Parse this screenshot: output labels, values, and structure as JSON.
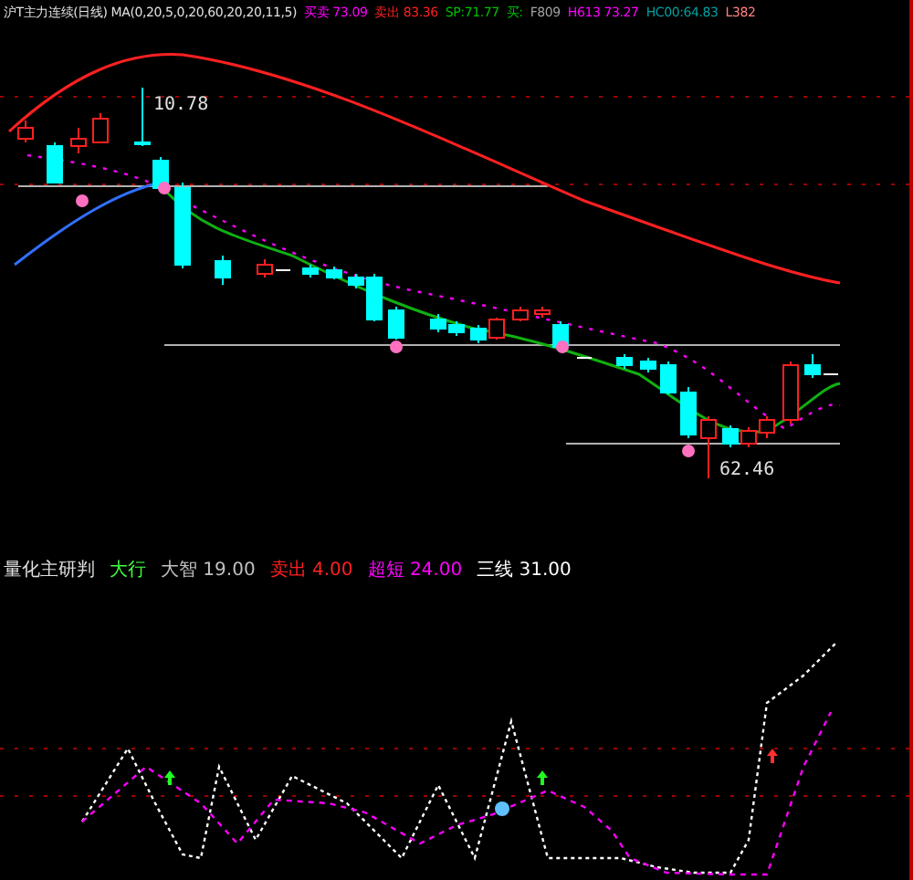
{
  "main_header": {
    "title": "沪T主力连续(日线) MA(0,20,5,0,20,60,20,20,11,5)",
    "readings": [
      {
        "label": "买卖 73.09",
        "color": "#ff00ff"
      },
      {
        "label": "卖出 83.36",
        "color": "#ff2020"
      },
      {
        "label": "SP:71.77",
        "color": "#00c000"
      },
      {
        "label": "买:",
        "color": "#00c000"
      },
      {
        "label": "F809",
        "color": "#a0a0a0"
      },
      {
        "label": "H613 73.27",
        "color": "#ff00ff"
      },
      {
        "label": "HC00:64.83",
        "color": "#00a0a0"
      },
      {
        "label": "L382",
        "color": "#ff8080"
      }
    ]
  },
  "price_labels": [
    {
      "text": "10.78"
    },
    {
      "text": "62.46"
    }
  ],
  "indicator_header": {
    "title": "量化主研判",
    "readings": [
      {
        "label": "大行",
        "color": "#40ff40"
      },
      {
        "label": "大智 19.00",
        "color": "#c0c0c0"
      },
      {
        "label": "卖出 4.00",
        "color": "#ff2020"
      },
      {
        "label": "超短 24.00",
        "color": "#ff00ff"
      },
      {
        "label": "三线 31.00",
        "color": "#ffffff"
      }
    ]
  }
}
